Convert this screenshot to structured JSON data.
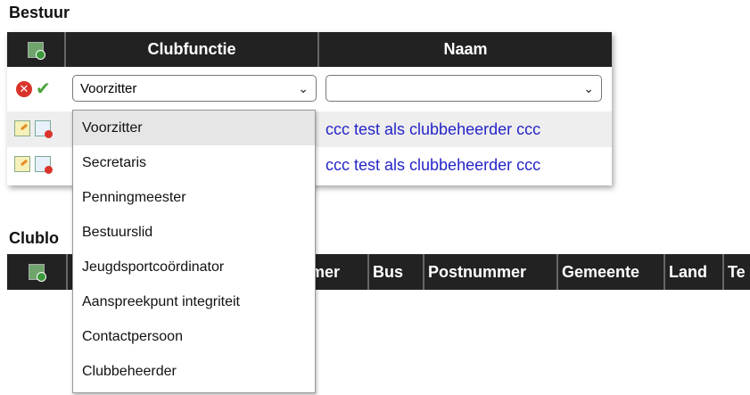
{
  "bestuur": {
    "title": "Bestuur",
    "columns": {
      "functie": "Clubfunctie",
      "naam": "Naam"
    },
    "edit_row": {
      "functie_value": "Voorzitter",
      "naam_value": ""
    },
    "rows": [
      {
        "naam": "ccc test als clubbeheerder ccc"
      },
      {
        "naam": "ccc test als clubbeheerder ccc"
      }
    ]
  },
  "clublokalen": {
    "title": "Clublo",
    "columns": [
      "mer",
      "Bus",
      "Postnummer",
      "Gemeente",
      "Land",
      "Te"
    ]
  },
  "dropdown": {
    "options": [
      "Voorzitter",
      "Secretaris",
      "Penningmeester",
      "Bestuurslid",
      "Jeugdsportcoördinator",
      "Aanspreekpunt integriteit",
      "Contactpersoon",
      "Clubbeheerder"
    ],
    "selected_index": 0
  },
  "colors": {
    "header_bg": "#222222",
    "link": "#2525c9",
    "ok": "#4aa33c",
    "cancel": "#d9342b"
  }
}
